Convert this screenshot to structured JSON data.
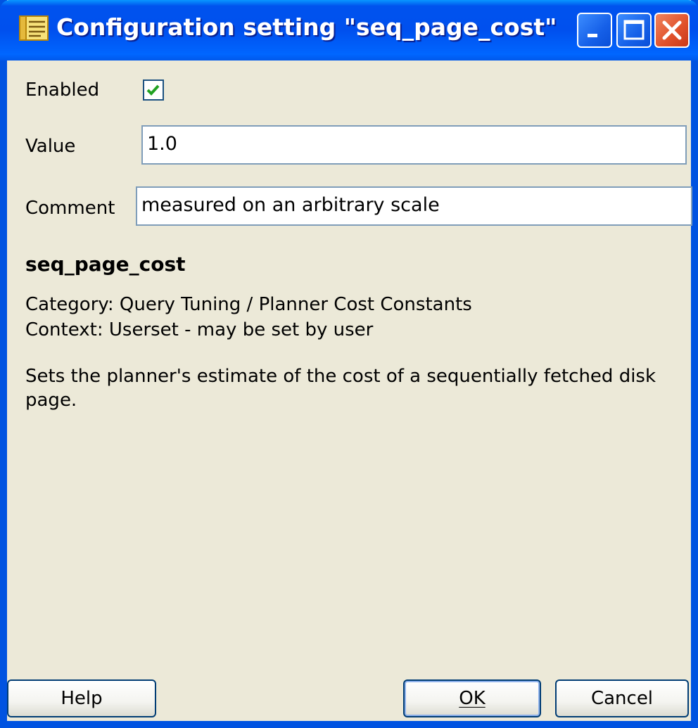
{
  "window": {
    "title": "Configuration setting \"seq_page_cost\"",
    "controls": [
      "minimize-icon",
      "maximize-icon",
      "close-icon"
    ]
  },
  "form": {
    "enabled_label": "Enabled",
    "enabled_checked": true,
    "value_label": "Value",
    "value": "1.0",
    "comment_label": "Comment",
    "comment": "measured on an arbitrary scale"
  },
  "description": {
    "name": "seq_page_cost",
    "category": "Category: Query Tuning / Planner Cost Constants",
    "context": "Context: Userset - may be set by user",
    "text": "Sets the planner's estimate of the cost of a sequentially fetched disk page."
  },
  "buttons": {
    "help": "Help",
    "ok": "OK",
    "cancel": "Cancel"
  },
  "colors": {
    "titlebar": "#0053ee",
    "dialog_bg": "#ece9d8",
    "close_button": "#e0502a",
    "checkmark": "#21a121"
  }
}
